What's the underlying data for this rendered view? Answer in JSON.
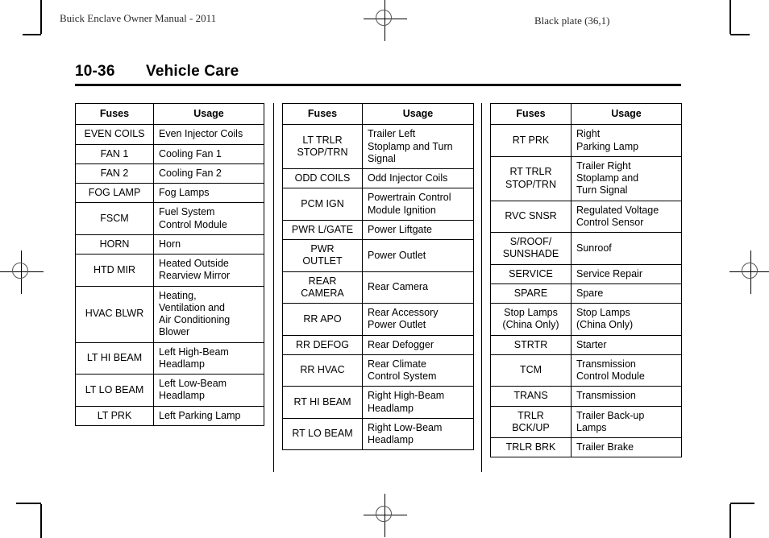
{
  "running_head": {
    "left": "Buick Enclave Owner Manual - 2011",
    "right": "Black plate (36,1)"
  },
  "page": {
    "number": "10-36",
    "title": "Vehicle Care"
  },
  "columns": [
    {
      "name": "fuse-table-1",
      "headers": {
        "fuses": "Fuses",
        "usage": "Usage"
      },
      "rows": [
        {
          "fuse": "EVEN COILS",
          "usage": "Even Injector Coils"
        },
        {
          "fuse": "FAN 1",
          "usage": "Cooling Fan 1"
        },
        {
          "fuse": "FAN 2",
          "usage": "Cooling Fan 2"
        },
        {
          "fuse": "FOG LAMP",
          "usage": "Fog Lamps"
        },
        {
          "fuse": "FSCM",
          "usage": "Fuel System\nControl Module"
        },
        {
          "fuse": "HORN",
          "usage": "Horn"
        },
        {
          "fuse": "HTD MIR",
          "usage": "Heated Outside\nRearview Mirror"
        },
        {
          "fuse": "HVAC BLWR",
          "usage": "Heating,\nVentilation and\nAir Conditioning\nBlower"
        },
        {
          "fuse": "LT HI BEAM",
          "usage": "Left High-Beam\nHeadlamp"
        },
        {
          "fuse": "LT LO BEAM",
          "usage": "Left Low-Beam\nHeadlamp"
        },
        {
          "fuse": "LT PRK",
          "usage": "Left Parking Lamp"
        }
      ]
    },
    {
      "name": "fuse-table-2",
      "headers": {
        "fuses": "Fuses",
        "usage": "Usage"
      },
      "rows": [
        {
          "fuse": "LT TRLR\nSTOP/TRN",
          "usage": "Trailer Left\nStoplamp and Turn\nSignal"
        },
        {
          "fuse": "ODD COILS",
          "usage": "Odd Injector Coils"
        },
        {
          "fuse": "PCM IGN",
          "usage": "Powertrain Control\nModule Ignition"
        },
        {
          "fuse": "PWR L/GATE",
          "usage": "Power Liftgate"
        },
        {
          "fuse": "PWR\nOUTLET",
          "usage": "Power Outlet"
        },
        {
          "fuse": "REAR\nCAMERA",
          "usage": "Rear Camera"
        },
        {
          "fuse": "RR APO",
          "usage": "Rear Accessory\nPower Outlet"
        },
        {
          "fuse": "RR DEFOG",
          "usage": "Rear Defogger"
        },
        {
          "fuse": "RR HVAC",
          "usage": "Rear Climate\nControl System"
        },
        {
          "fuse": "RT HI BEAM",
          "usage": "Right High-Beam\nHeadlamp"
        },
        {
          "fuse": "RT LO BEAM",
          "usage": "Right Low-Beam\nHeadlamp"
        }
      ]
    },
    {
      "name": "fuse-table-3",
      "headers": {
        "fuses": "Fuses",
        "usage": "Usage"
      },
      "rows": [
        {
          "fuse": "RT PRK",
          "usage": "Right\nParking Lamp"
        },
        {
          "fuse": "RT TRLR\nSTOP/TRN",
          "usage": "Trailer Right\nStoplamp and\nTurn Signal"
        },
        {
          "fuse": "RVC SNSR",
          "usage": "Regulated Voltage\nControl Sensor"
        },
        {
          "fuse": "S/ROOF/\nSUNSHADE",
          "usage": "Sunroof"
        },
        {
          "fuse": "SERVICE",
          "usage": "Service Repair"
        },
        {
          "fuse": "SPARE",
          "usage": "Spare"
        },
        {
          "fuse": "Stop Lamps\n(China Only)",
          "usage": "Stop Lamps\n(China Only)"
        },
        {
          "fuse": "STRTR",
          "usage": "Starter"
        },
        {
          "fuse": "TCM",
          "usage": "Transmission\nControl Module"
        },
        {
          "fuse": "TRANS",
          "usage": "Transmission"
        },
        {
          "fuse": "TRLR\nBCK/UP",
          "usage": "Trailer Back-up\nLamps"
        },
        {
          "fuse": "TRLR BRK",
          "usage": "Trailer Brake"
        }
      ]
    }
  ]
}
